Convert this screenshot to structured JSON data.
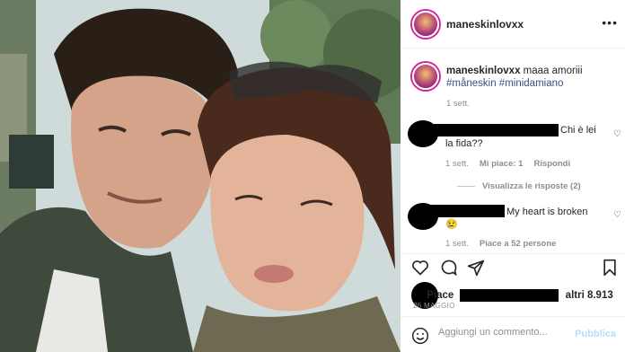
{
  "post": {
    "username": "maneskinlovxx",
    "more_label": "•••",
    "caption": {
      "username": "maneskinlovxx",
      "text": "maaa amoriii",
      "hashtags": "#måneskin #minidamiano",
      "time": "1 sett."
    }
  },
  "comments": [
    {
      "text_a": "Chi è lei",
      "text_b": "la fida??",
      "time": "1 sett.",
      "likes": "Mi piace: 1",
      "reply": "Rispondi",
      "view_replies": "Visualizza le risposte (2)"
    },
    {
      "text_a": "My heart is broken",
      "emoji": "😢",
      "time": "1 sett.",
      "likes": "Piace a 52 persone"
    }
  ],
  "likes_line": {
    "prefix": "Piace",
    "suffix": "altri 8.913"
  },
  "date": "26 MAGGIO",
  "add_comment": {
    "placeholder": "Aggiungi un commento...",
    "publish": "Pubblica"
  },
  "colors": {
    "hashtag": "#385185",
    "meta": "#8e8e8e",
    "publish": "#b2dffc"
  }
}
